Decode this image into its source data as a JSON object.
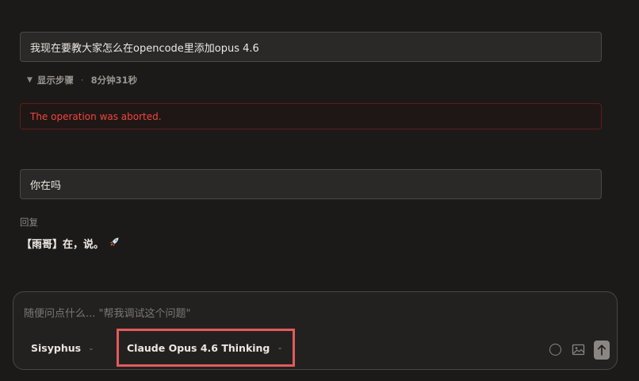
{
  "conversation": {
    "messages": [
      {
        "text": "我现在要教大家怎么在opencode里添加opus 4.6"
      },
      {
        "text": "你在吗"
      }
    ],
    "steps": {
      "label": "显示步骤",
      "separator": "·",
      "duration": "8分钟31秒"
    },
    "error": "The operation was aborted.",
    "reply": {
      "label": "回复",
      "text": "【雨哥】在，说。"
    }
  },
  "composer": {
    "placeholder": "随便问点什么... \"帮我调试这个问题\"",
    "agent": "Sisyphus",
    "model": "Claude Opus 4.6 Thinking"
  },
  "icons": {
    "expand": "triangle-down-icon",
    "reply_emoji": "rocket-icon",
    "chevron": "chevron-down-icon",
    "circle": "circle-icon",
    "image": "image-icon",
    "send": "arrow-up-icon"
  },
  "colors": {
    "error_text": "#f2453c",
    "highlight_box": "#e15b5b"
  }
}
